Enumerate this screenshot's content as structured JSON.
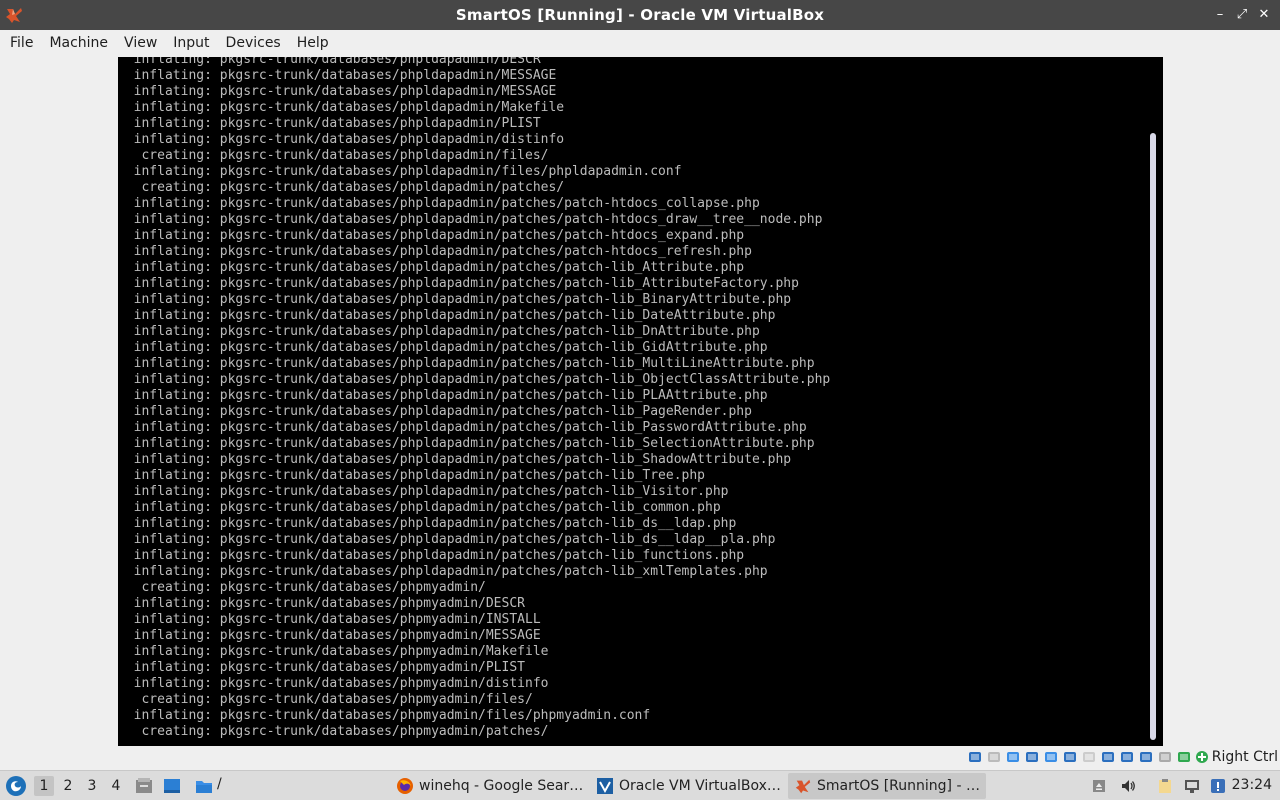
{
  "window": {
    "title": "SmartOS [Running] - Oracle VM VirtualBox",
    "buttons": {
      "minimize": "–",
      "maximize": "⤢",
      "close": "✕"
    }
  },
  "menu": [
    "File",
    "Machine",
    "View",
    "Input",
    "Devices",
    "Help"
  ],
  "console": {
    "lines": [
      "  inflating: pkgsrc-trunk/databases/phpldapadmin/DESCR",
      "  inflating: pkgsrc-trunk/databases/phpldapadmin/MESSAGE",
      "  inflating: pkgsrc-trunk/databases/phpldapadmin/MESSAGE",
      "  inflating: pkgsrc-trunk/databases/phpldapadmin/Makefile",
      "  inflating: pkgsrc-trunk/databases/phpldapadmin/PLIST",
      "  inflating: pkgsrc-trunk/databases/phpldapadmin/distinfo",
      "   creating: pkgsrc-trunk/databases/phpldapadmin/files/",
      "  inflating: pkgsrc-trunk/databases/phpldapadmin/files/phpldapadmin.conf",
      "   creating: pkgsrc-trunk/databases/phpldapadmin/patches/",
      "  inflating: pkgsrc-trunk/databases/phpldapadmin/patches/patch-htdocs_collapse.php",
      "  inflating: pkgsrc-trunk/databases/phpldapadmin/patches/patch-htdocs_draw__tree__node.php",
      "  inflating: pkgsrc-trunk/databases/phpldapadmin/patches/patch-htdocs_expand.php",
      "  inflating: pkgsrc-trunk/databases/phpldapadmin/patches/patch-htdocs_refresh.php",
      "  inflating: pkgsrc-trunk/databases/phpldapadmin/patches/patch-lib_Attribute.php",
      "  inflating: pkgsrc-trunk/databases/phpldapadmin/patches/patch-lib_AttributeFactory.php",
      "  inflating: pkgsrc-trunk/databases/phpldapadmin/patches/patch-lib_BinaryAttribute.php",
      "  inflating: pkgsrc-trunk/databases/phpldapadmin/patches/patch-lib_DateAttribute.php",
      "  inflating: pkgsrc-trunk/databases/phpldapadmin/patches/patch-lib_DnAttribute.php",
      "  inflating: pkgsrc-trunk/databases/phpldapadmin/patches/patch-lib_GidAttribute.php",
      "  inflating: pkgsrc-trunk/databases/phpldapadmin/patches/patch-lib_MultiLineAttribute.php",
      "  inflating: pkgsrc-trunk/databases/phpldapadmin/patches/patch-lib_ObjectClassAttribute.php",
      "  inflating: pkgsrc-trunk/databases/phpldapadmin/patches/patch-lib_PLAAttribute.php",
      "  inflating: pkgsrc-trunk/databases/phpldapadmin/patches/patch-lib_PageRender.php",
      "  inflating: pkgsrc-trunk/databases/phpldapadmin/patches/patch-lib_PasswordAttribute.php",
      "  inflating: pkgsrc-trunk/databases/phpldapadmin/patches/patch-lib_SelectionAttribute.php",
      "  inflating: pkgsrc-trunk/databases/phpldapadmin/patches/patch-lib_ShadowAttribute.php",
      "  inflating: pkgsrc-trunk/databases/phpldapadmin/patches/patch-lib_Tree.php",
      "  inflating: pkgsrc-trunk/databases/phpldapadmin/patches/patch-lib_Visitor.php",
      "  inflating: pkgsrc-trunk/databases/phpldapadmin/patches/patch-lib_common.php",
      "  inflating: pkgsrc-trunk/databases/phpldapadmin/patches/patch-lib_ds__ldap.php",
      "  inflating: pkgsrc-trunk/databases/phpldapadmin/patches/patch-lib_ds__ldap__pla.php",
      "  inflating: pkgsrc-trunk/databases/phpldapadmin/patches/patch-lib_functions.php",
      "  inflating: pkgsrc-trunk/databases/phpldapadmin/patches/patch-lib_xmlTemplates.php",
      "   creating: pkgsrc-trunk/databases/phpmyadmin/",
      "  inflating: pkgsrc-trunk/databases/phpmyadmin/DESCR",
      "  inflating: pkgsrc-trunk/databases/phpmyadmin/INSTALL",
      "  inflating: pkgsrc-trunk/databases/phpmyadmin/MESSAGE",
      "  inflating: pkgsrc-trunk/databases/phpmyadmin/Makefile",
      "  inflating: pkgsrc-trunk/databases/phpmyadmin/PLIST",
      "  inflating: pkgsrc-trunk/databases/phpmyadmin/distinfo",
      "   creating: pkgsrc-trunk/databases/phpmyadmin/files/",
      "  inflating: pkgsrc-trunk/databases/phpmyadmin/files/phpmyadmin.conf",
      "   creating: pkgsrc-trunk/databases/phpmyadmin/patches/"
    ]
  },
  "statusbar": {
    "icons": [
      "hard-disk-icon",
      "optical-drive-icon",
      "audio-icon",
      "network-icon",
      "usb-icon",
      "shared-folders-icon",
      "display-icon",
      "video-capture-icon",
      "cpu-icon",
      "recording-icon",
      "mouse-integration-icon",
      "keyboard-icon"
    ],
    "host_key": "Right Ctrl"
  },
  "taskbar": {
    "workspaces": [
      "1",
      "2",
      "3",
      "4"
    ],
    "active_workspace": "1",
    "quicklaunch_path": "/",
    "tasks": [
      {
        "label": "winehq - Google Sear…",
        "icon": "firefox-icon",
        "active": false
      },
      {
        "label": "Oracle VM VirtualBox…",
        "icon": "virtualbox-manager-icon",
        "active": false
      },
      {
        "label": "SmartOS [Running] - …",
        "icon": "virtualbox-vm-icon",
        "active": true
      }
    ],
    "clock": "23:24"
  }
}
